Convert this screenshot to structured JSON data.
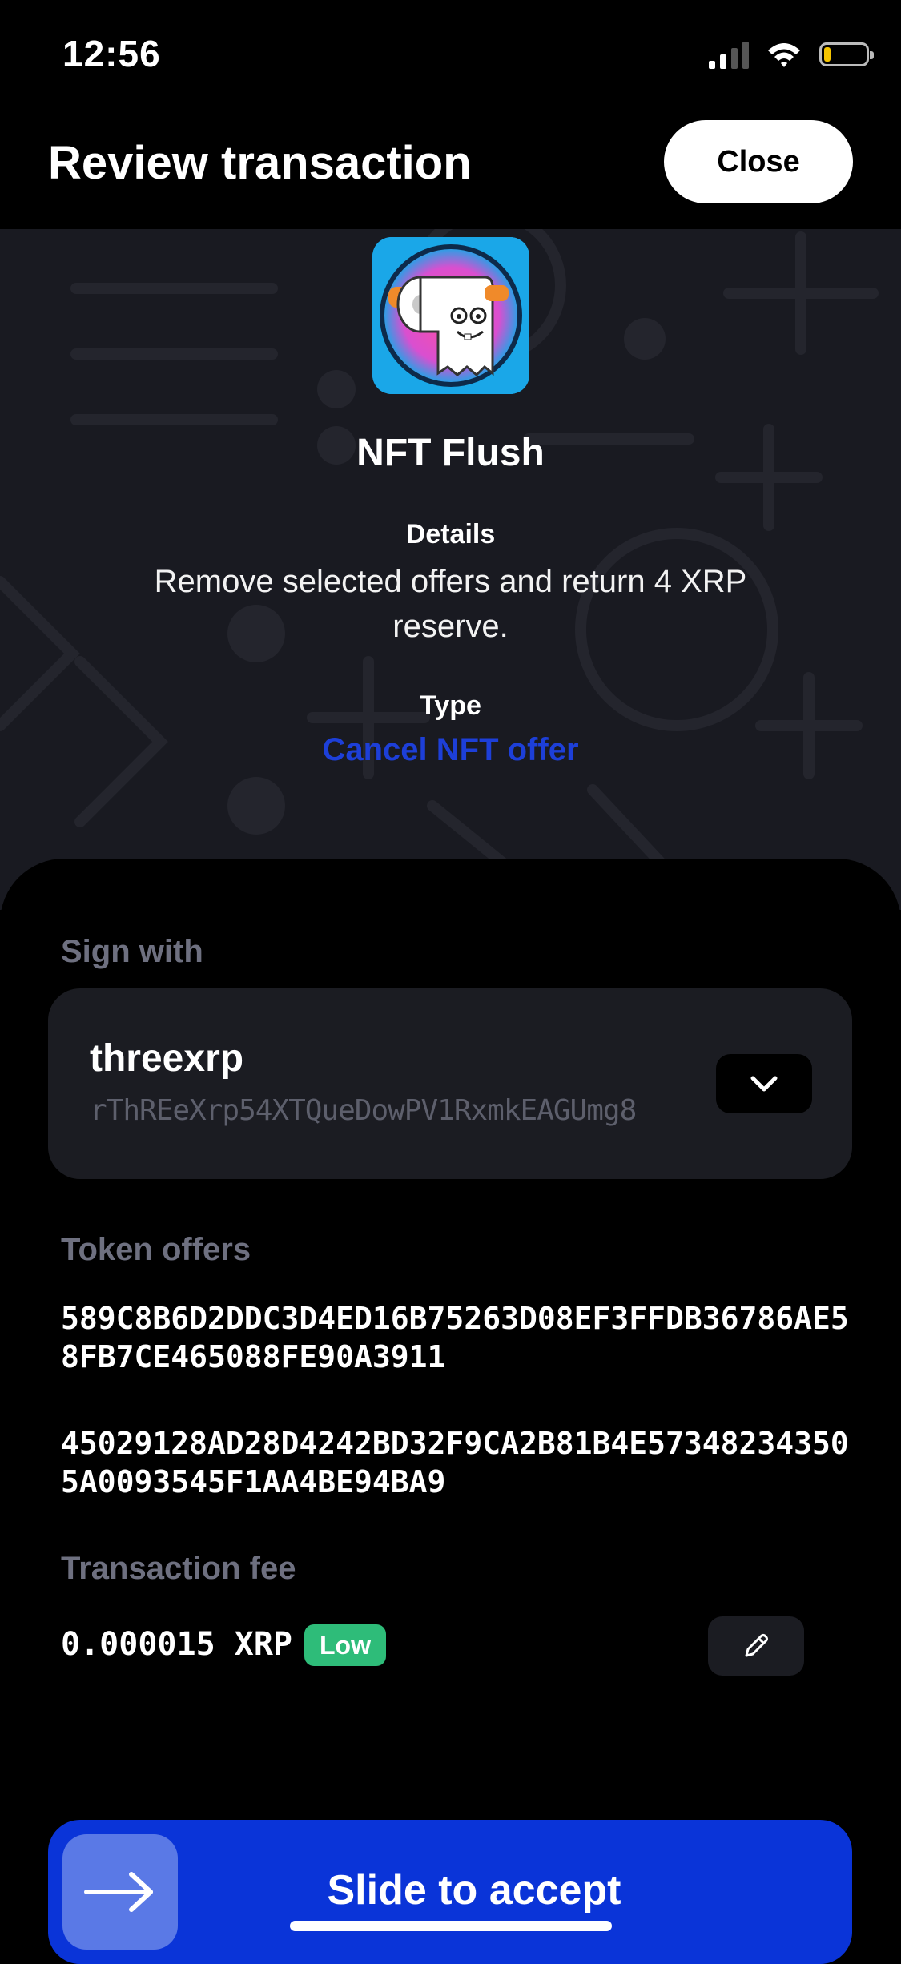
{
  "status_bar": {
    "time": "12:56"
  },
  "header": {
    "title": "Review transaction",
    "close_label": "Close"
  },
  "hero": {
    "app_name": "NFT Flush",
    "details_label": "Details",
    "details_text": "Remove selected offers and return 4 XRP reserve.",
    "type_label": "Type",
    "type_value": "Cancel NFT offer",
    "type_color": "#1d3fd8"
  },
  "sign_with": {
    "label": "Sign with",
    "account_name": "threexrp",
    "account_address": "rThREeXrp54XTQueDowPV1RxmkEAGUmg8"
  },
  "token_offers": {
    "label": "Token offers",
    "offers": [
      "589C8B6D2DDC3D4ED16B75263D08EF3FFDB36786AE58FB7CE465088FE90A3911",
      "45029128AD28D4242BD32F9CA2B81B4E573482343505A0093545F1AA4BE94BA9"
    ]
  },
  "fee": {
    "label": "Transaction fee",
    "value": "0.000015 XRP",
    "badge": "Low",
    "badge_color": "#2ebc79"
  },
  "slider": {
    "label": "Slide to accept",
    "color": "#0a34d8"
  }
}
